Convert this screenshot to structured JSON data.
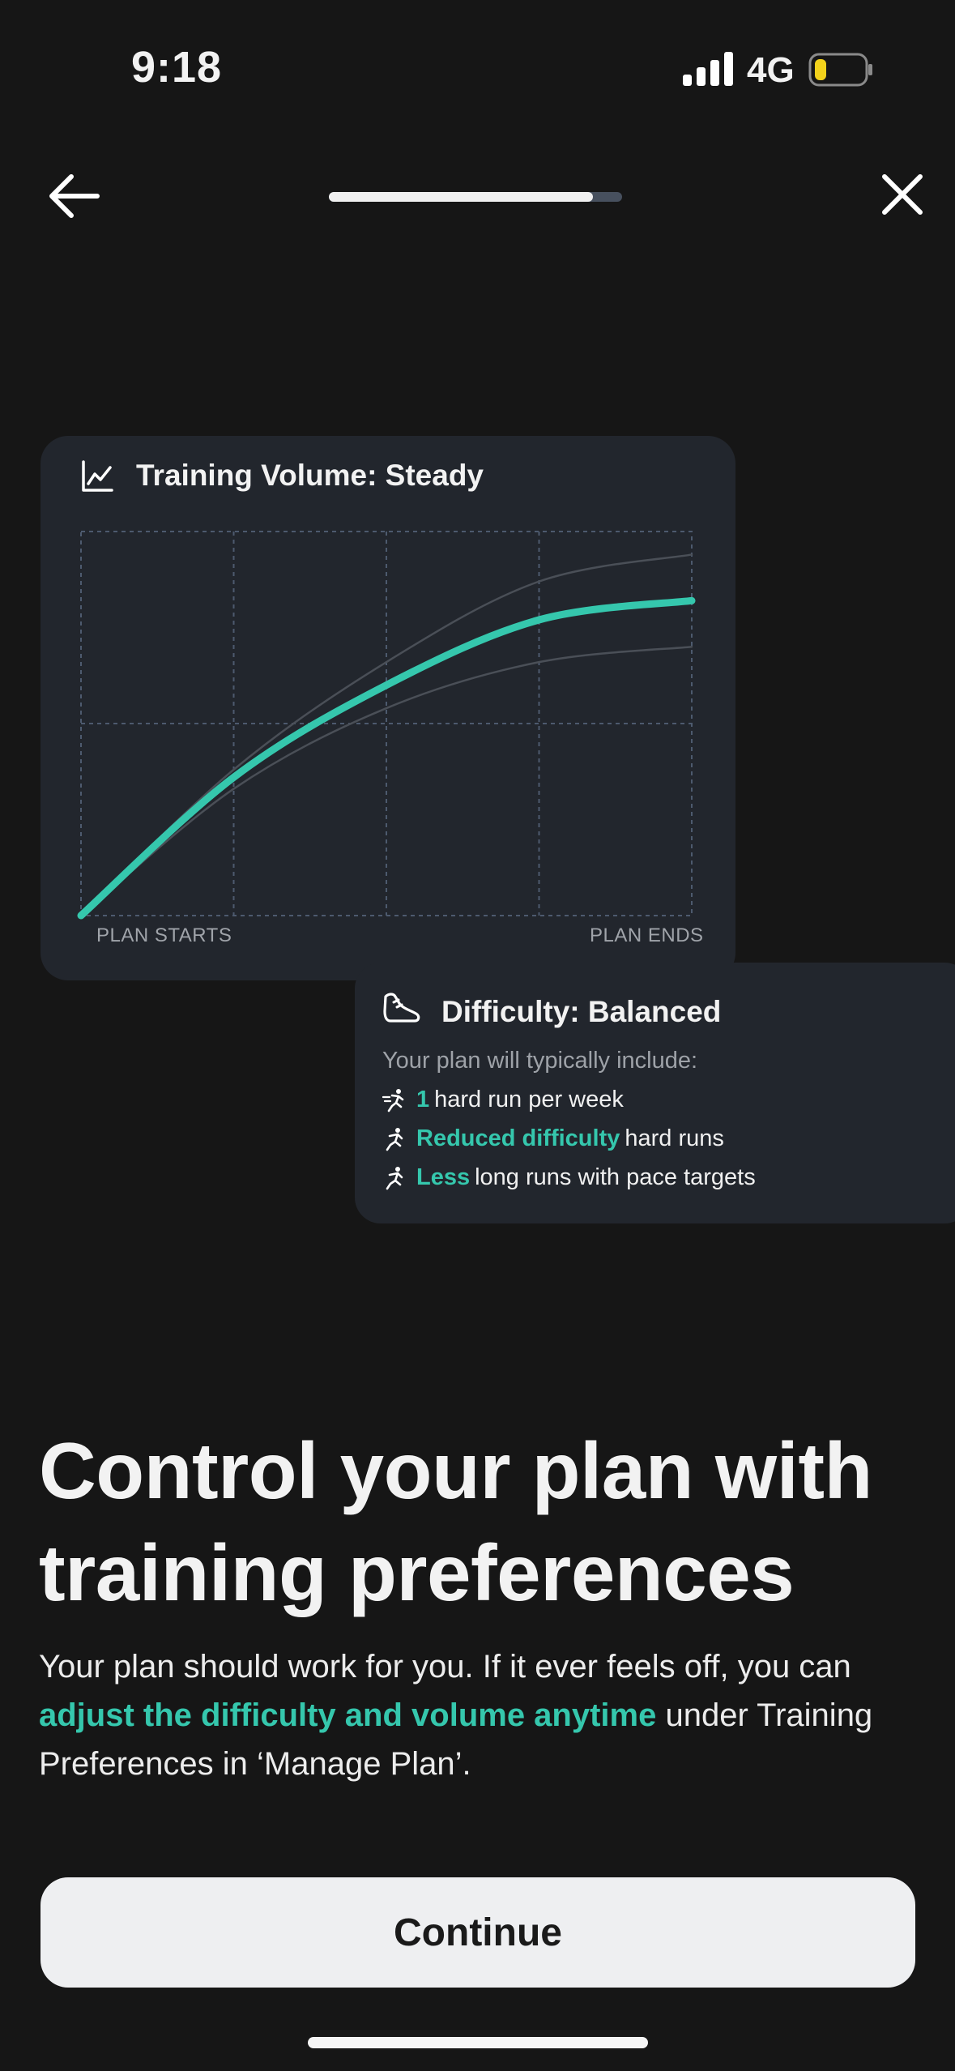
{
  "status_bar": {
    "time": "9:18",
    "network": "4G",
    "battery_color": "#f3d21b"
  },
  "nav": {
    "progress_fraction": 0.9
  },
  "volume_card": {
    "title": "Training Volume: Steady",
    "start_label": "PLAN STARTS",
    "end_label": "PLAN ENDS"
  },
  "chart_data": {
    "type": "line",
    "x": [
      0,
      0.25,
      0.5,
      0.75,
      1
    ],
    "series": [
      {
        "values": [
          0,
          0.36,
          0.6,
          0.77,
          0.82
        ],
        "color": "#35c7ad"
      },
      {
        "values": [
          0,
          0.38,
          0.66,
          0.87,
          0.94
        ],
        "color": "#4a4f57"
      },
      {
        "values": [
          0,
          0.33,
          0.54,
          0.66,
          0.7
        ],
        "color": "#4a4f57"
      }
    ],
    "ylim": [
      0,
      1
    ],
    "grid": true,
    "xticks": [
      "PLAN STARTS",
      "PLAN ENDS"
    ]
  },
  "difficulty_card": {
    "title": "Difficulty: Balanced",
    "subtitle": "Your plan will typically include:",
    "items": [
      {
        "highlight": "1",
        "text": "hard run per week",
        "icon": "fast-runner-icon"
      },
      {
        "highlight": "Reduced difficulty",
        "text": "hard runs",
        "icon": "runner-icon"
      },
      {
        "highlight": "Less",
        "text": "long runs with pace targets",
        "icon": "runner-icon"
      }
    ]
  },
  "headline": "Control your plan with training preferences",
  "body": {
    "part1": "Your plan should work for you. If it ever feels off, you can ",
    "highlight": "adjust the difficulty and volume anytime",
    "part2": " under Training Preferences in ‘Manage Plan’."
  },
  "continue_label": "Continue",
  "colors": {
    "accent": "#35c7ad",
    "background": "#161616",
    "card": "#22262d"
  }
}
